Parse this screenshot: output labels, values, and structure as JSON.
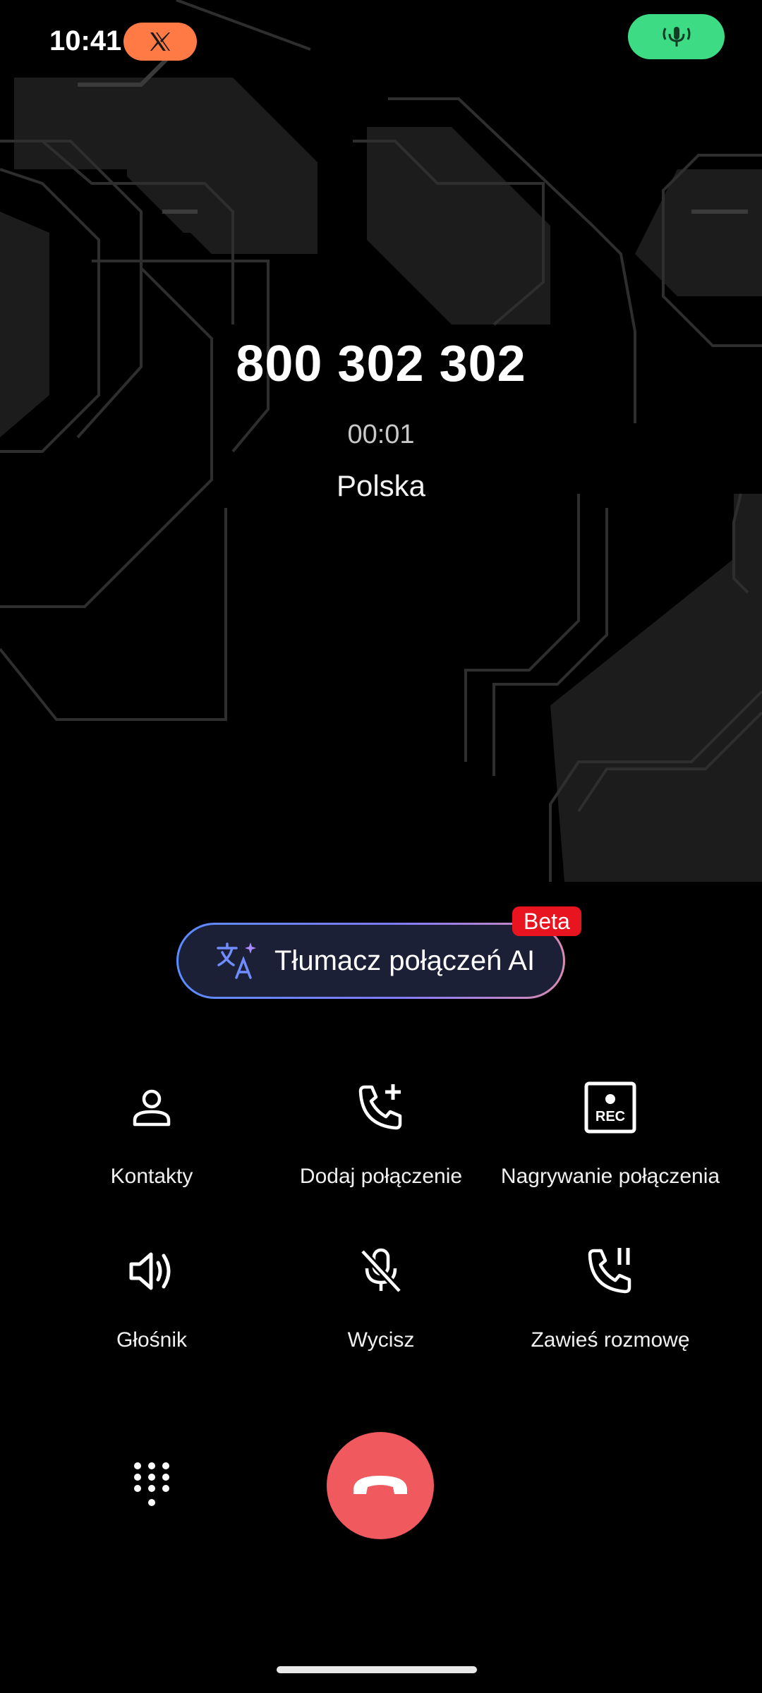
{
  "status_bar": {
    "time": "10:41",
    "x_app_icon": "x-logo-icon",
    "mic_indicator_icon": "microphone-broadcast-icon"
  },
  "call": {
    "number": "800 302 302",
    "duration": "00:01",
    "location": "Polska"
  },
  "translator": {
    "label": "Tłumacz połączeń AI",
    "badge": "Beta",
    "icon": "translate-icon"
  },
  "actions": [
    {
      "label": "Kontakty",
      "icon": "contacts-icon"
    },
    {
      "label": "Dodaj połączenie",
      "icon": "add-call-icon"
    },
    {
      "label": "Nagrywanie połączenia",
      "icon": "rec-icon"
    },
    {
      "label": "Głośnik",
      "icon": "speaker-icon"
    },
    {
      "label": "Wycisz",
      "icon": "mic-off-icon"
    },
    {
      "label": "Zawieś rozmowę",
      "icon": "hold-call-icon"
    }
  ],
  "rec_icon_text": "REC",
  "bottom": {
    "keypad_icon": "keypad-icon",
    "end_call_icon": "end-call-icon"
  },
  "colors": {
    "x_pill": "#FF7A45",
    "mic_pill": "#3DDC84",
    "end_call": "#F05A5F",
    "beta_badge": "#E8141F",
    "translator_bg": "#1B2037"
  }
}
